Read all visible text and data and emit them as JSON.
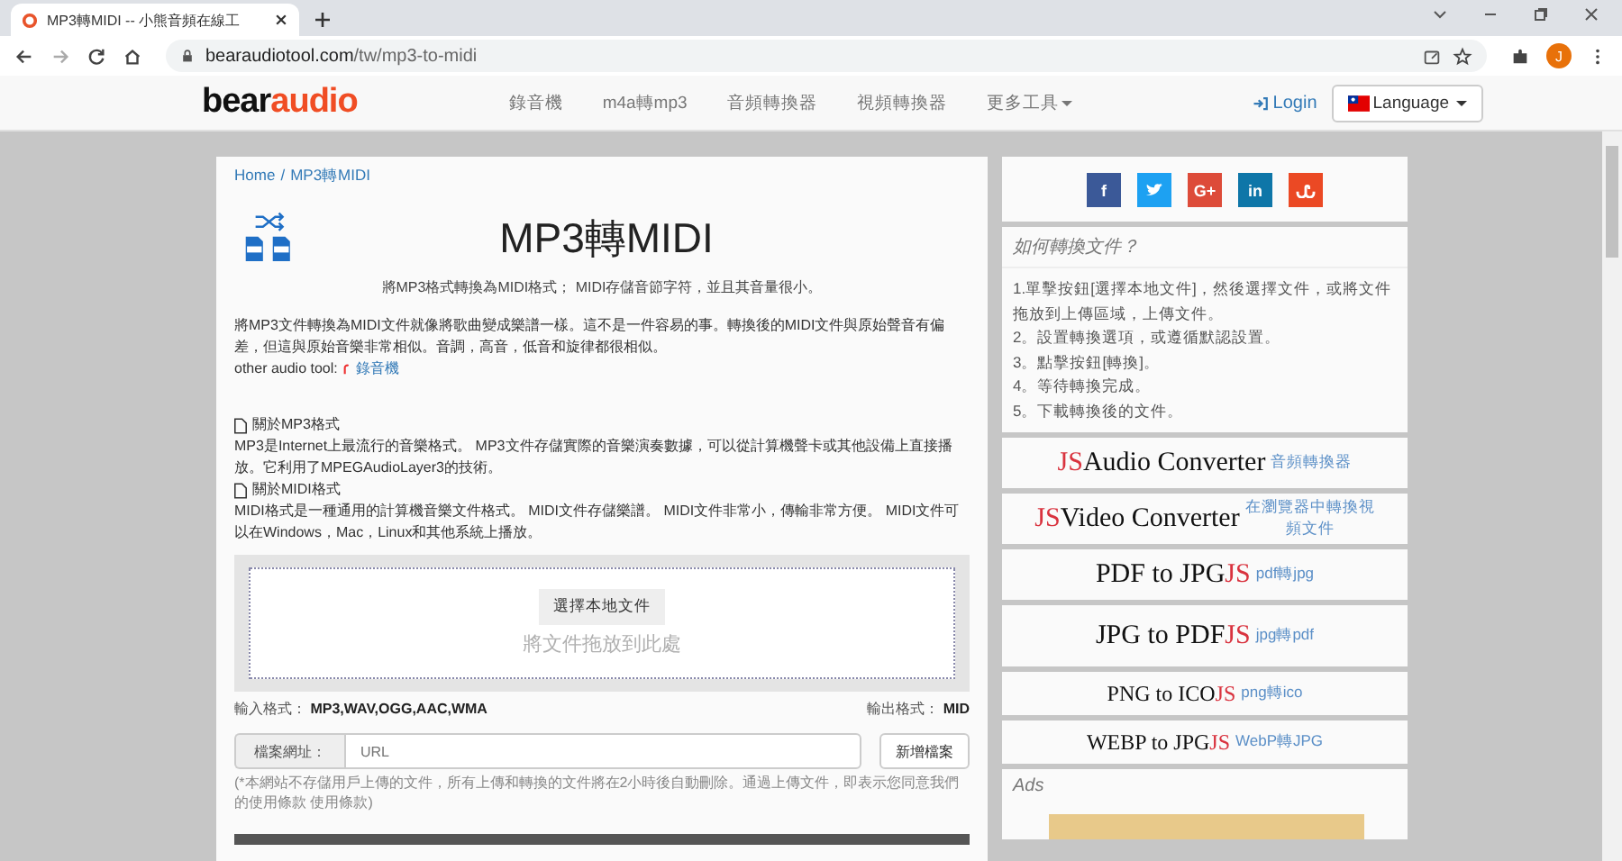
{
  "browser": {
    "tab_title": "MP3轉MIDI -- 小熊音頻在線工",
    "url_host": "bearaudiotool.com",
    "url_path": "/tw/mp3-to-midi",
    "avatar": "J"
  },
  "site_nav": {
    "logo": [
      {
        "text": "bear",
        "kind": "plain"
      },
      {
        "text": "audio",
        "kind": "accent"
      }
    ],
    "items": [
      {
        "label": "錄音機",
        "dropdown": false
      },
      {
        "label": "m4a轉mp3",
        "dropdown": false
      },
      {
        "label": "音頻轉換器",
        "dropdown": false
      },
      {
        "label": "視頻轉換器",
        "dropdown": false
      },
      {
        "label": "更多工具",
        "dropdown": true
      }
    ],
    "login": "Login",
    "language": "Language"
  },
  "breadcrumb": {
    "home": "Home",
    "separator": "/",
    "current": "MP3轉MIDI"
  },
  "title": "MP3轉MIDI",
  "subtitle": "將MP3格式轉換為MIDI格式； MIDI存儲音節字符，並且其音量很小。",
  "intro": "將MP3文件轉換為MIDI文件就像將歌曲變成樂譜一樣。這不是一件容易的事。轉換後的MIDI文件與原始聲音有偏差，但這與原始音樂非常相似。音調，高音，低音和旋律都很相似。",
  "other_tools": {
    "label": "other audio tool:",
    "link": "錄音機"
  },
  "sections": [
    {
      "heading": "關於MP3格式",
      "text": "MP3是Internet上最流行的音樂格式。 MP3文件存儲實際的音樂演奏數據，可以從計算機聲卡或其他設備上直接播放。它利用了MPEGAudioLayer3的技術。"
    },
    {
      "heading": "關於MIDI格式",
      "text": "MIDI格式是一種通用的計算機音樂文件格式。 MIDI文件存儲樂譜。 MIDI文件非常小，傳輸非常方便。 MIDI文件可以在Windows，Mac，Linux和其他系統上播放。"
    }
  ],
  "upload": {
    "button": "選擇本地文件",
    "hint": "將文件拖放到此處"
  },
  "formats": {
    "input_label": "輸入格式：",
    "input_value": "MP3,WAV,OGG,AAC,WMA",
    "output_label": "輸出格式：",
    "output_value": "MID"
  },
  "url_form": {
    "label": "檔案網址：",
    "placeholder": "URL",
    "button": "新增檔案"
  },
  "notice": "(*本網站不存儲用戶上傳的文件，所有上傳和轉換的文件將在2小時後自動刪除。通過上傳文件，即表示您同意我們的使用條款 使用條款)",
  "share": [
    {
      "kind": "letter",
      "glyph": "f",
      "color": "#3b5998"
    },
    {
      "kind": "bird",
      "color": "#1da1f2"
    },
    {
      "kind": "letter",
      "glyph": "G+",
      "color": "#dd4b39"
    },
    {
      "kind": "letter",
      "glyph": "in",
      "color": "#0e76a8"
    },
    {
      "kind": "stumble",
      "color": "#eb4924"
    }
  ],
  "howto": {
    "title": "如何轉換文件？",
    "steps": [
      "1.單擊按鈕[選擇本地文件]，然後選擇文件，或將文件拖放到上傳區域，上傳文件。",
      "2。設置轉換選項，或遵循默認設置。",
      "3。點擊按鈕[轉換]。",
      "4。等待轉換完成。",
      "5。下載轉換後的文件。"
    ]
  },
  "tools": [
    {
      "kind": "large",
      "logo": [
        {
          "text": "JS",
          "kind": "accent"
        },
        {
          "text": "Audio Converter",
          "kind": "plain"
        }
      ],
      "link": "音頻轉換器"
    },
    {
      "kind": "large",
      "logo": [
        {
          "text": "JS",
          "kind": "accent"
        },
        {
          "text": "Video Converter",
          "kind": "plain"
        }
      ],
      "link": "在瀏覽器中轉換視頻文件"
    },
    {
      "kind": "large",
      "logo": [
        {
          "text": "PDF to JPG",
          "kind": "plain"
        },
        {
          "text": "JS",
          "kind": "accent"
        }
      ],
      "link": "pdf轉jpg"
    },
    {
      "kind": "large",
      "logo": [
        {
          "text": "JPG to PDF",
          "kind": "plain"
        },
        {
          "text": "JS",
          "kind": "accent"
        }
      ],
      "link": "jpg轉pdf"
    },
    {
      "kind": "small",
      "logo": [
        {
          "text": "PNG to ICO",
          "kind": "plain"
        },
        {
          "text": "JS",
          "kind": "accent"
        }
      ],
      "link": "png轉ico"
    },
    {
      "kind": "small",
      "logo": [
        {
          "text": "WEBP to JPG",
          "kind": "plain"
        },
        {
          "text": "JS",
          "kind": "accent"
        }
      ],
      "link": "WebP轉JPG"
    }
  ],
  "ads_title": "Ads"
}
